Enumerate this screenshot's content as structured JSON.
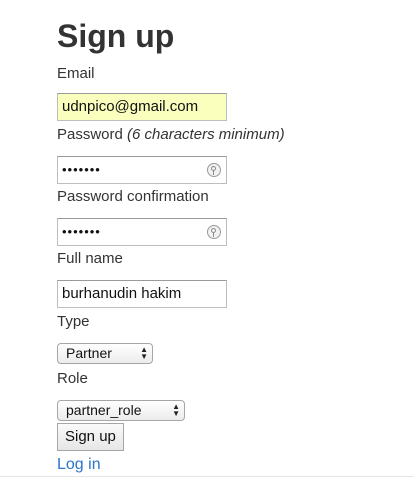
{
  "title": "Sign up",
  "email": {
    "label": "Email",
    "value": "udnpico@gmail.com"
  },
  "password": {
    "label": "Password",
    "hint": "(6 characters minimum)",
    "value": "•••••••"
  },
  "password_confirmation": {
    "label": "Password confirmation",
    "value": "•••••••"
  },
  "full_name": {
    "label": "Full name",
    "value": "burhanudin hakim"
  },
  "type": {
    "label": "Type",
    "selected": "Partner"
  },
  "role": {
    "label": "Role",
    "selected": "partner_role"
  },
  "submit_label": "Sign up",
  "login_link": "Log in",
  "colors": {
    "autofill_background": "#faffbd",
    "link": "#2a74c9",
    "text": "#333333"
  }
}
